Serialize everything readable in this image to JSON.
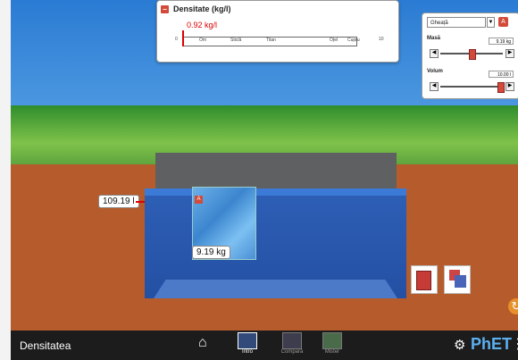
{
  "density_panel": {
    "title": "Densitate (kg/l)",
    "value": "0.92 kg/l",
    "min": "0",
    "max": "10",
    "materials": [
      "Om",
      "Sticlă",
      "Titan",
      "Oțel",
      "Cupru"
    ]
  },
  "controls": {
    "material": "Gheață",
    "mass_label": "Masă",
    "mass_value": "9.19 kg",
    "mass_fraction": 0.5,
    "volume_label": "Volum",
    "volume_value": "10.00 l",
    "volume_fraction": 1.0
  },
  "scene": {
    "water_volume": "109.19 l",
    "block_mass": "9.19 kg"
  },
  "navbar": {
    "title": "Densitatea",
    "tabs": [
      "Intro",
      "Compară",
      "Mister"
    ],
    "brand": "PhET"
  },
  "colors": {
    "accent": "#d24b3a",
    "water": "#2d5fb6",
    "ground": "#b65b2b"
  }
}
